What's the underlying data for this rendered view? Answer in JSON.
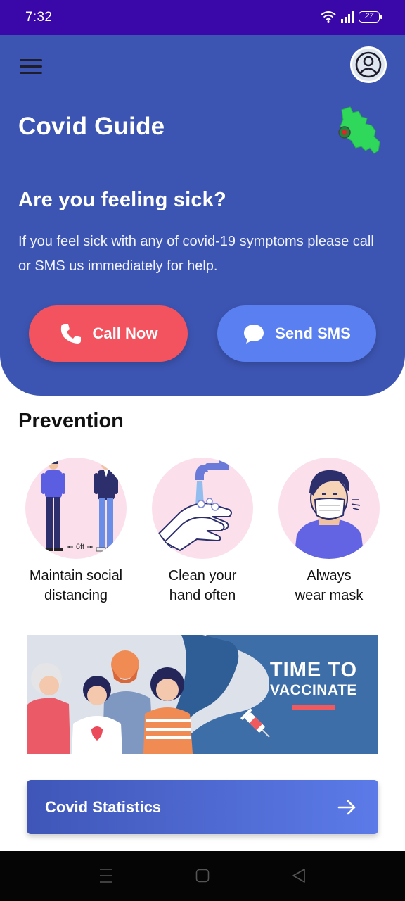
{
  "status_bar": {
    "time": "7:32",
    "battery": "27"
  },
  "header": {
    "title": "Covid Guide"
  },
  "sick": {
    "title": "Are you feeling sick?",
    "description": "If you feel sick with any of covid-19 symptoms please call or SMS us immediately for help."
  },
  "actions": {
    "call_label": "Call Now",
    "sms_label": "Send SMS"
  },
  "prevention": {
    "title": "Prevention",
    "distance_note": "6ft",
    "items": [
      {
        "label": "Maintain social\ndistancing",
        "icon": "social-distancing-icon"
      },
      {
        "label": "Clean your\nhand often",
        "icon": "hand-washing-icon"
      },
      {
        "label": "Always\nwear mask",
        "icon": "face-mask-icon"
      }
    ]
  },
  "banner": {
    "line1": "TIME TO",
    "line2": "VACCINATE"
  },
  "stats": {
    "label": "Covid Statistics"
  },
  "colors": {
    "status_bar": "#3a08a8",
    "primary": "#3d55b2",
    "call": "#f2535f",
    "sms": "#5a7ff0",
    "pink": "#fbe0ec"
  }
}
